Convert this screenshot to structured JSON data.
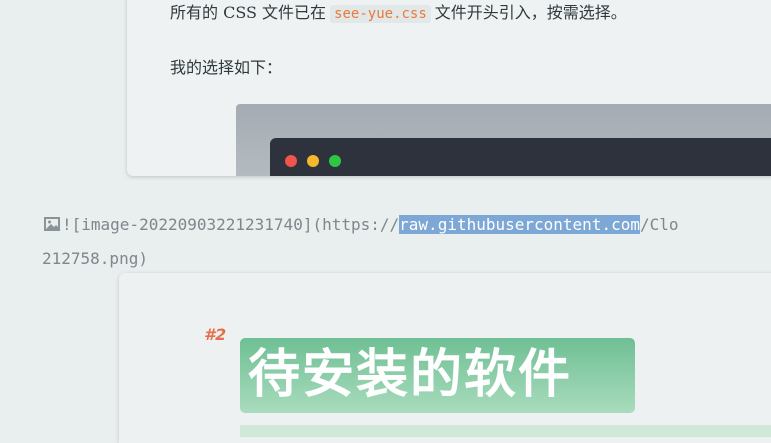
{
  "preview": {
    "line1_prefix": "所有的 CSS 文件已在",
    "line1_code": "see-yue.css",
    "line1_suffix": "文件开头引入，按需选择。",
    "line2": "我的选择如下："
  },
  "source": {
    "prefix": "![image-20220903221231740](https://",
    "selected": "raw.githubusercontent.com",
    "suffix": "/Clo",
    "line2": "212758.png)"
  },
  "image_card": {
    "badge": "#2",
    "title": "待安装的软件"
  },
  "colors": {
    "selection": "#7da7d4",
    "code": "#e87a3c",
    "badge": "#e4714e",
    "title_bg": "#6fbf94"
  },
  "icons": {
    "image_icon": "image-icon"
  }
}
